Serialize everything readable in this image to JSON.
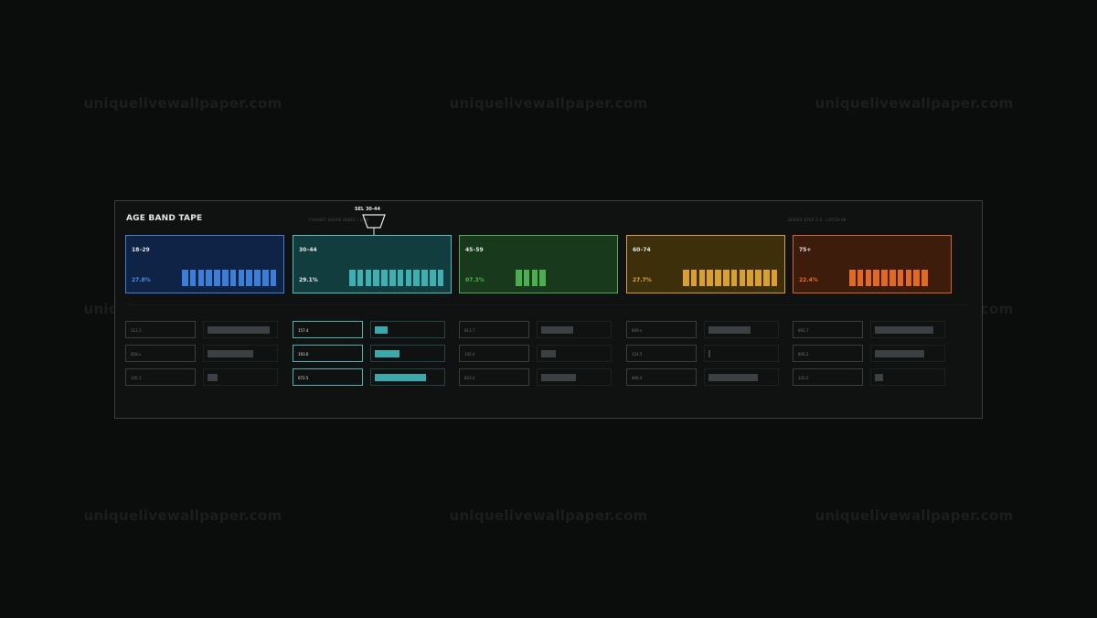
{
  "watermark": "uniquelivewallpaper.com",
  "panel": {
    "title": "AGE BAND TAPE",
    "subcaption_left": "COHORT SHARE INDEX / LIVE",
    "subcaption_right": "SERIES STEP 2.0 · LATCH 08",
    "cursor_label": "SEL 30-44"
  },
  "colors": {
    "background": "#0b0c0c",
    "band_18_29": "#3d7fd6",
    "band_30_44": "#4ac0c0",
    "band_45_59": "#4cae4f",
    "band_60_74": "#d69f2d",
    "band_75_plus": "#d9661f"
  },
  "bands": [
    {
      "label": "18–29",
      "pct": "27.8%",
      "bar_count": 12,
      "selected": false,
      "rows": [
        {
          "value": "112.1",
          "level": 0.92
        },
        {
          "value": "858.x",
          "level": 0.67
        },
        {
          "value": "145.1",
          "level": 0.15
        }
      ]
    },
    {
      "label": "30–44",
      "pct": "29.1%",
      "bar_count": 12,
      "selected": true,
      "rows": [
        {
          "value": "157.4",
          "level": 0.19
        },
        {
          "value": "193.6",
          "level": 0.37
        },
        {
          "value": "072.5",
          "level": 0.76
        }
      ]
    },
    {
      "label": "45–59",
      "pct": "07.3%",
      "bar_count": 4,
      "selected": false,
      "rows": [
        {
          "value": "813.7",
          "level": 0.47
        },
        {
          "value": "142.4",
          "level": 0.22
        },
        {
          "value": "823.4",
          "level": 0.51
        }
      ]
    },
    {
      "label": "60–74",
      "pct": "27.7%",
      "bar_count": 12,
      "selected": false,
      "rows": [
        {
          "value": "849.x",
          "level": 0.62
        },
        {
          "value": "124.5",
          "level": 0.03
        },
        {
          "value": "896.4",
          "level": 0.73
        }
      ]
    },
    {
      "label": "75+",
      "pct": "22.4%",
      "bar_count": 10,
      "selected": false,
      "rows": [
        {
          "value": "892.7",
          "level": 0.86
        },
        {
          "value": "806.2",
          "level": 0.73
        },
        {
          "value": "141.2",
          "level": 0.12
        }
      ]
    }
  ]
}
